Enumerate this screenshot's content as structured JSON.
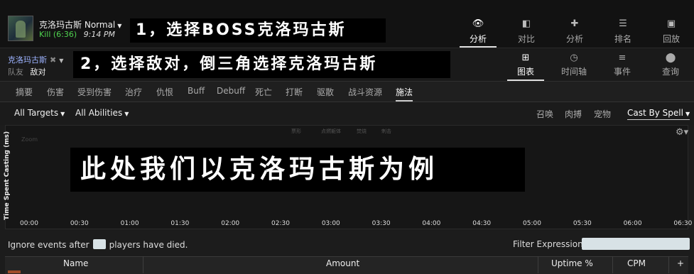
{
  "fight": {
    "boss_name": "克洛玛古斯",
    "difficulty": "Normal",
    "result": "Kill (6:36)",
    "time": "9:14 PM"
  },
  "annotations": {
    "step1": "1，选择BOSS克洛玛古斯",
    "step2": "2，选择敌对，倒三角选择克洛玛古斯",
    "step3": "此处我们以克洛玛古斯为例"
  },
  "top_nav": [
    {
      "label": "分析",
      "icon": "eye-icon",
      "active": true
    },
    {
      "label": "对比",
      "icon": "compare-icon",
      "active": false
    },
    {
      "label": "分析",
      "icon": "puzzle-icon",
      "active": false
    },
    {
      "label": "排名",
      "icon": "ranking-icon",
      "active": false
    },
    {
      "label": "回放",
      "icon": "replay-icon",
      "active": false
    }
  ],
  "target": {
    "name": "克洛玛古斯",
    "ally": "队友",
    "enemy": "敌对"
  },
  "section_nav": [
    {
      "label": "图表",
      "icon": "grid-icon",
      "active": true
    },
    {
      "label": "时间轴",
      "icon": "clock-icon",
      "active": false
    },
    {
      "label": "事件",
      "icon": "list-icon",
      "active": false
    },
    {
      "label": "查询",
      "icon": "map-pin-icon",
      "active": false
    }
  ],
  "tabs": [
    "摘要",
    "伤害",
    "受到伤害",
    "治疗",
    "仇恨",
    "Buff",
    "Debuff",
    "死亡",
    "打断",
    "驱散",
    "战斗资源",
    "施法"
  ],
  "active_tab": "施法",
  "filters": {
    "targets": "All Targets",
    "abilities": "All Abilities",
    "summon": "召唤",
    "meat": "肉搏",
    "pet": "宠物",
    "cast_by_spell": "Cast By Spell"
  },
  "chart_data": {
    "type": "line",
    "ylabel": "Time Spent Casting (ms)",
    "x_ticks": [
      "00:00",
      "00:30",
      "01:00",
      "01:30",
      "02:00",
      "02:30",
      "03:00",
      "03:30",
      "04:00",
      "04:30",
      "05:00",
      "05:30",
      "06:00",
      "06:30"
    ],
    "zoom_label": "Zoom",
    "legend": [
      "票形",
      "点燃躯体",
      "焚烧",
      "刺击"
    ],
    "series": []
  },
  "ignore": {
    "before": "Ignore events after",
    "after": "players have died."
  },
  "filter_expression_label": "Filter Expression:",
  "table": {
    "headers": [
      "Name",
      "Amount",
      "Uptime %",
      "CPM",
      "+"
    ]
  },
  "colors": {
    "kill": "#4fd34f",
    "target_name": "#9db3ff",
    "background": "#1c1c1c"
  }
}
